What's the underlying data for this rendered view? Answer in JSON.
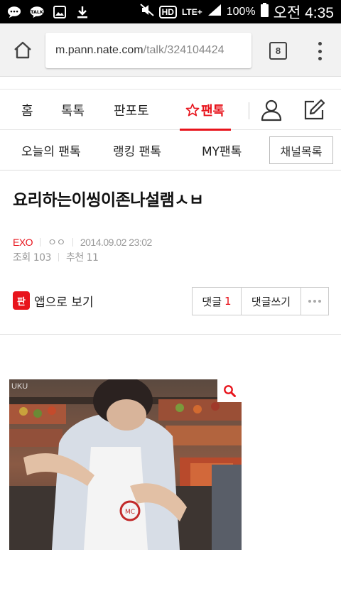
{
  "status_bar": {
    "left_icons": [
      "chat-icon",
      "talk-icon",
      "gallery-icon",
      "download-icon"
    ],
    "battery": "100%",
    "time": "오전 4:35",
    "hd_label": "HD",
    "lte_label": "LTE+"
  },
  "browser": {
    "url_host": "m.pann.nate.com",
    "url_path": "/talk/324104424",
    "tab_count": "8"
  },
  "top_nav": {
    "items": [
      "홈",
      "톡톡",
      "판포토",
      "팬톡"
    ],
    "active": "팬톡",
    "accent_color": "#e8141c"
  },
  "sub_nav": {
    "items": [
      "오늘의 팬톡",
      "랭킹 팬톡",
      "MY팬톡"
    ],
    "channel_button": "채널목록"
  },
  "article": {
    "title": "요리하는이씽이존나설램ㅅㅂ",
    "category": "EXO",
    "author": "ㅇㅇ",
    "datetime": "2014.09.02 23:02",
    "views": "조회 103",
    "recommends": "추천 11",
    "app_link": "앱으로 보기",
    "app_logo": "판",
    "comment_label": "댓글",
    "comment_count": "1",
    "write_comment": "댓글쓰기",
    "watermark": "UKU"
  }
}
